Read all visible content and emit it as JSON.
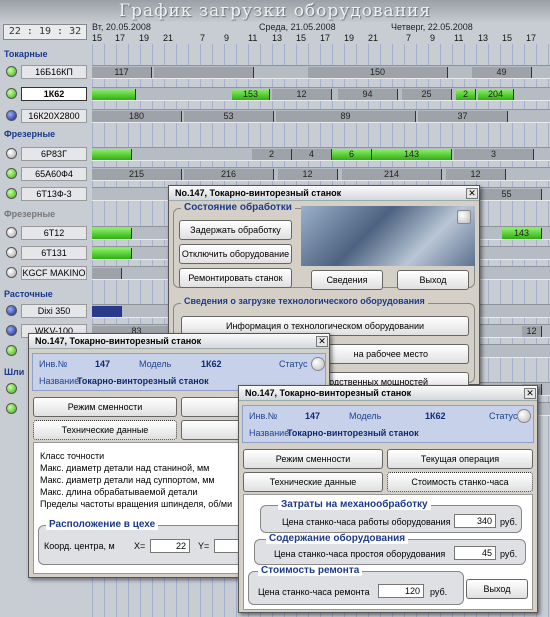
{
  "title": "График загрузки оборудования",
  "clock": "22 : 19 : 32",
  "days": [
    "Вт, 20.05.2008",
    "Среда, 21.05.2008",
    "Четверг, 22.05.2008"
  ],
  "hours": [
    "15",
    "17",
    "19",
    "21",
    "7",
    "9",
    "11",
    "13",
    "15",
    "17",
    "19",
    "21",
    "7",
    "9",
    "11",
    "13",
    "15",
    "17",
    "19",
    "21"
  ],
  "groups": [
    "Токарные",
    "Фрезерные",
    "Фрезерные",
    "Расточные",
    "Шли"
  ],
  "machines": [
    {
      "name": "16Б16КП",
      "segs": [
        "117",
        "",
        "150",
        "49"
      ]
    },
    {
      "name": "1К62",
      "segs": [
        "153",
        "12",
        "94",
        "25",
        "2",
        "204"
      ]
    },
    {
      "name": "16К20Х2800",
      "segs": [
        "180",
        "53",
        "89",
        "37"
      ]
    },
    {
      "name": "6Р83Г",
      "segs": [
        "2",
        "4",
        "6",
        "143",
        "3"
      ]
    },
    {
      "name": "65А60Ф4",
      "segs": [
        "215",
        "216",
        "12",
        "214",
        "12"
      ]
    },
    {
      "name": "6Т13Ф-3",
      "segs": [
        "55"
      ]
    },
    {
      "name": "6Т12",
      "segs": [
        "143"
      ]
    },
    {
      "name": "6Т131",
      "segs": []
    },
    {
      "name": "KGCF MAKINO",
      "segs": []
    },
    {
      "name": "Dixi 350",
      "segs": []
    },
    {
      "name": "WKV-100",
      "segs": [
        "83",
        "12"
      ]
    },
    {
      "name": "",
      "segs": []
    },
    {
      "name": "",
      "segs": []
    },
    {
      "name": "",
      "segs": []
    }
  ],
  "win1": {
    "title": "No.147,  Токарно-винторезный станок",
    "state_label": "Состояние обработки",
    "btn_delay": "Задержать обработку",
    "btn_disable": "Отключить оборудование",
    "btn_repair": "Ремонтировать станок",
    "btn_info": "Сведения",
    "btn_exit": "Выход",
    "load_label": "Сведения о загрузке технологического оборудования",
    "btn_tech": "Информация о технологическом оборудовании",
    "btn_work": "на рабочее место",
    "btn_cap": "водственных мощностей"
  },
  "win2": {
    "title": "No.147,  Токарно-винторезный станок",
    "inv_label": "Инв.№",
    "inv": "147",
    "model_label": "Модель",
    "model": "1К62",
    "status_label": "Статус",
    "name_label": "Название",
    "name": "Токарно-винторезный станок",
    "btn_shift": "Режим сменности",
    "btn_cur": "Теку",
    "btn_tech": "Технические данные",
    "btn_cost": "Стоимо",
    "specs": [
      "Класс точности",
      "Макс. диаметр детали над станиной,   мм",
      "Макс. диаметр детали над суппортом, мм",
      "Макс. длина обрабатываемой детали",
      "Пределы частоты вращения шпинделя, об/ми"
    ],
    "loc_label": "Расположение в цехе",
    "coord_label": "Коорд. центра, м",
    "x_label": "X=",
    "x_val": "22",
    "y_label": "Y=",
    "y_val": "4"
  },
  "win3": {
    "title": "No.147,  Токарно-винторезный станок",
    "inv_label": "Инв.№",
    "inv": "147",
    "model_label": "Модель",
    "model": "1К62",
    "status_label": "Статус",
    "name_label": "Название",
    "name": "Токарно-винторезный станок",
    "btn_shift": "Режим сменности",
    "btn_cur": "Текущая операция",
    "btn_tech": "Технические данные",
    "btn_cost": "Стоимость станко-часа",
    "cost_label": "Затраты на механообработку",
    "cost_text": "Цена станко-часа работы оборудования",
    "cost_val": "340",
    "cost_unit": "руб.",
    "maint_label": "Содержание оборудования",
    "maint_text": "Цена станко-часа простоя оборудования",
    "maint_val": "45",
    "maint_unit": "руб.",
    "repair_label": "Стоимость ремонта",
    "repair_text": "Цена станко-часа ремонта",
    "repair_val": "120",
    "repair_unit": "руб.",
    "btn_exit": "Выход"
  }
}
